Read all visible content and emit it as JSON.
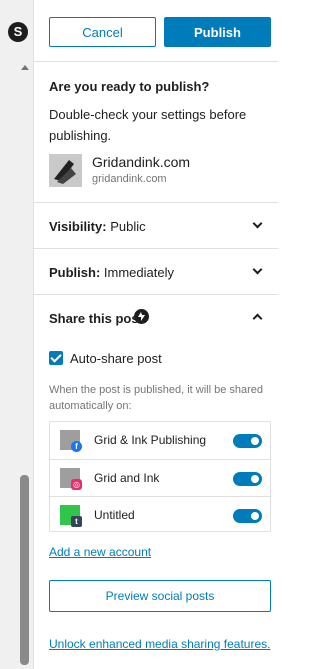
{
  "header": {
    "cancel_label": "Cancel",
    "publish_label": "Publish"
  },
  "prepublish": {
    "title": "Are you ready to publish?",
    "description": "Double-check your settings before publishing."
  },
  "site": {
    "name": "Gridandink.com",
    "url": "gridandink.com"
  },
  "visibility": {
    "label": "Visibility:",
    "value": "Public"
  },
  "publish_time": {
    "label": "Publish:",
    "value": "Immediately"
  },
  "share": {
    "title": "Share this post",
    "autoshare_label": "Auto-share post",
    "autoshare_checked": true,
    "note": "When the post is published, it will be shared automatically on:",
    "accounts": [
      {
        "name": "Grid & Ink Publishing",
        "network": "facebook",
        "enabled": true
      },
      {
        "name": "Grid and Ink",
        "network": "instagram",
        "enabled": true
      },
      {
        "name": "Untitled",
        "network": "tumblr",
        "enabled": true
      }
    ],
    "add_account_label": "Add a new account",
    "preview_label": "Preview social posts",
    "unlock_label": "Unlock enhanced media sharing features."
  },
  "colors": {
    "accent": "#007cba",
    "text": "#1e1e1e",
    "muted": "#757575",
    "border": "#e0e0e0"
  }
}
